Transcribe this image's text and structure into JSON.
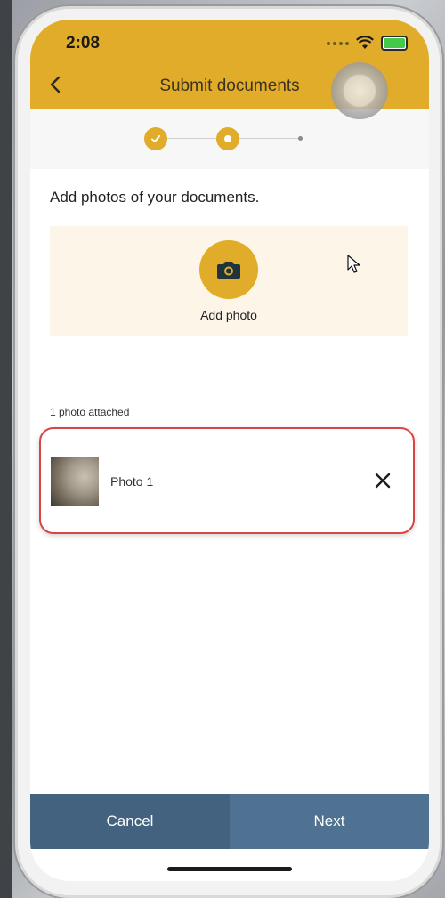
{
  "status_bar": {
    "time": "2:08",
    "signal_icon": "signal-dots-icon",
    "wifi_icon": "wifi-icon",
    "battery_icon": "battery-charging-icon"
  },
  "header": {
    "title": "Submit documents",
    "back_icon": "chevron-left-icon",
    "background_color": "#e1ac2a"
  },
  "progress": {
    "steps": [
      {
        "state": "completed",
        "icon": "check-icon"
      },
      {
        "state": "current"
      },
      {
        "state": "upcoming"
      }
    ]
  },
  "instruction": "Add photos of your documents.",
  "add_photo": {
    "label": "Add photo",
    "icon": "camera-icon"
  },
  "attachments": {
    "count_label": "1 photo attached",
    "items": [
      {
        "name": "Photo 1",
        "remove_icon": "close-icon"
      }
    ]
  },
  "footer": {
    "cancel_label": "Cancel",
    "next_label": "Next",
    "cancel_color": "#43627f",
    "next_color": "#4f7192"
  },
  "colors": {
    "accent": "#e1ac2a",
    "highlight_border": "#d94545"
  }
}
